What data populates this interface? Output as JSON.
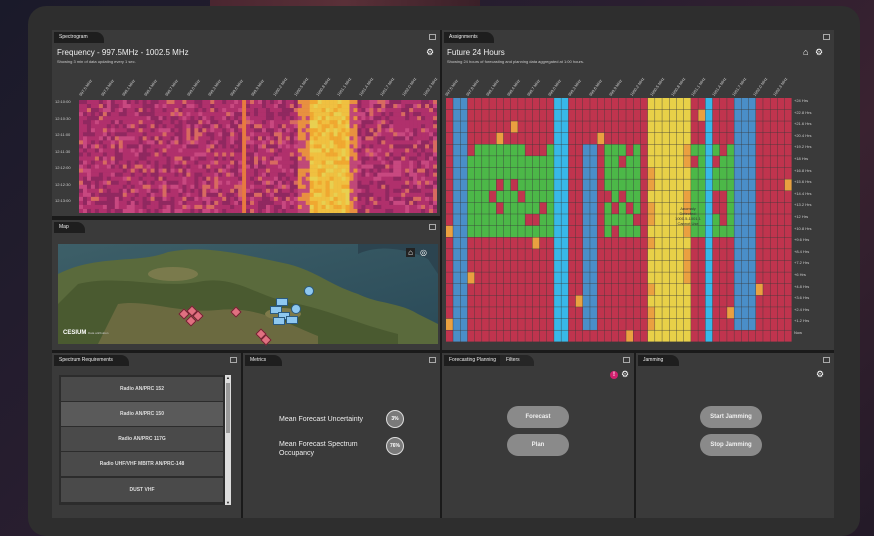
{
  "spectrogram": {
    "tab": "Spectrogram",
    "title": "Frequency - 997.5MHz - 1002.5 MHz",
    "subtitle": "Showing 3 min of data updating every 1 sec.",
    "time_labels": [
      "12:10:00",
      "12:10:30",
      "12:11:00",
      "12:11:30",
      "12:12:00",
      "12:12:30",
      "12:13:00"
    ],
    "freq_labels": [
      "997.5 MHz",
      "997.8 MHz",
      "998.1 MHz",
      "998.4 MHz",
      "998.7 MHz",
      "999.0 MHz",
      "999.3 MHz",
      "999.6 MHz",
      "999.9 MHz",
      "1000.2 MHz",
      "1000.5 MHz",
      "1000.8 MHz",
      "1001.1 MHz",
      "1001.4 MHz",
      "1001.7 MHz",
      "1002.0 MHz",
      "1002.3 MHz"
    ]
  },
  "map": {
    "tab": "Map",
    "attribution": "CESIUM",
    "attribution_sub": "Data attribution"
  },
  "assignments": {
    "tab": "Assignments",
    "title": "Future 24 Hours",
    "subtitle": "Showing 24 hours of forecasting and planning data aggregated at 1:00 hours.",
    "annotation": [
      "Anomaly",
      "Detected:",
      "1000.5-1001.1",
      "Cannot Use"
    ],
    "row_labels": [
      "+24 Hrs",
      "+22.8 Hrs",
      "+21.6 Hrs",
      "+20.4 Hrs",
      "+19.2 Hrs",
      "+18 Hrs",
      "+16.8 Hrs",
      "+15.6 Hrs",
      "+14.4 Hrs",
      "+13.2 Hrs",
      "+12 Hrs",
      "+10.8 Hrs",
      "+9.6 Hrs",
      "+8.4 Hrs",
      "+7.2 Hrs",
      "+6 Hrs",
      "+4.8 Hrs",
      "+3.6 Hrs",
      "+2.4 Hrs",
      "+1.2 Hrs",
      "Now"
    ],
    "col_labels": [
      "997.5 MHz",
      "997.8 MHz",
      "998.1 MHz",
      "998.4 MHz",
      "998.7 MHz",
      "999.0 MHz",
      "999.3 MHz",
      "999.6 MHz",
      "999.9 MHz",
      "1000.2 MHz",
      "1000.5 MHz",
      "1000.8 MHz",
      "1001.1 MHz",
      "1001.4 MHz",
      "1001.7 MHz",
      "1002.0 MHz",
      "1002.3 MHz"
    ]
  },
  "spectrum_requirements": {
    "tab": "Spectrum Requirements",
    "items": [
      "Radio AN/PRC 152",
      "Radio AN/PRC 150",
      "Radio AN/PRC 117G",
      "Radio UHF/VHF MBITR AN/PRC-148",
      "DUST VHF"
    ]
  },
  "metrics": {
    "tab": "Metrics",
    "uncertainty_label": "Mean Forecast Uncertainty",
    "uncertainty_value": "3%",
    "occupancy_label": "Mean Forecast Spectrum Occupancy",
    "occupancy_value": "76%"
  },
  "forecasting": {
    "tab": "Forecasting Planning",
    "tab2": "Filters",
    "forecast_button": "Forecast",
    "plan_button": "Plan"
  },
  "jamming": {
    "tab": "Jamming",
    "start_button": "Start Jamming",
    "stop_button": "Stop Jamming"
  },
  "colors": {
    "red": "#c0344e",
    "green": "#4cb848",
    "blue": "#4a8ec8",
    "cyan": "#38b8e8",
    "yellow": "#e8d048",
    "orange": "#eaa040",
    "magenta": "#b0306c"
  }
}
